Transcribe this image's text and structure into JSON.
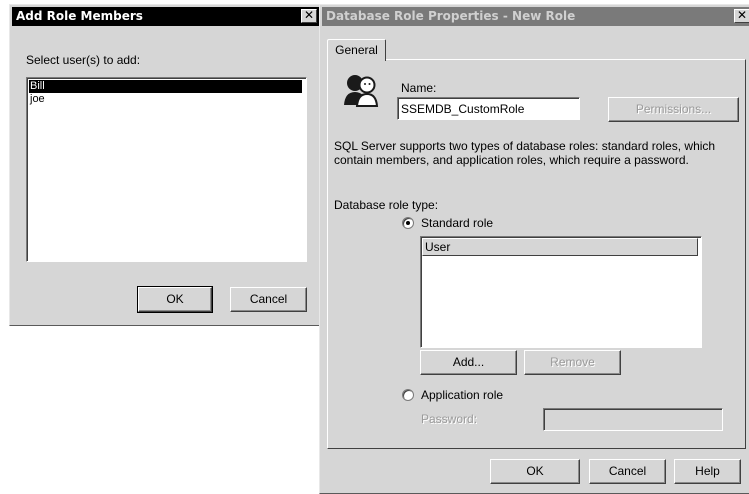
{
  "add_dialog": {
    "title": "Add Role Members",
    "close_glyph": "✕",
    "prompt": "Select user(s) to add:",
    "users": [
      "Bill",
      "joe"
    ],
    "selected_index": 0,
    "ok_label": "OK",
    "cancel_label": "Cancel"
  },
  "props_dialog": {
    "title": "Database Role Properties - New Role",
    "close_glyph": "✕",
    "tab_general": "General",
    "name_label": "Name:",
    "name_value": "SSEMDB_CustomRole",
    "permissions_label": "Permissions...",
    "description": "SQL Server supports two types of database roles: standard roles, which contain members, and application roles, which require a password.",
    "role_type_label": "Database role type:",
    "standard_role_label": "Standard role",
    "members_header": "User",
    "add_label": "Add...",
    "remove_label": "Remove",
    "application_role_label": "Application role",
    "password_label": "Password:",
    "password_value": "",
    "ok_label": "OK",
    "cancel_label": "Cancel",
    "help_label": "Help",
    "selected_role_type": "standard"
  },
  "icons": {
    "role_icon": "users-group-icon",
    "close_icon": "close-icon"
  },
  "colors": {
    "active_title": "#000000",
    "inactive_title": "#7a7a7a",
    "dialog_face": "#d6d6d6"
  }
}
